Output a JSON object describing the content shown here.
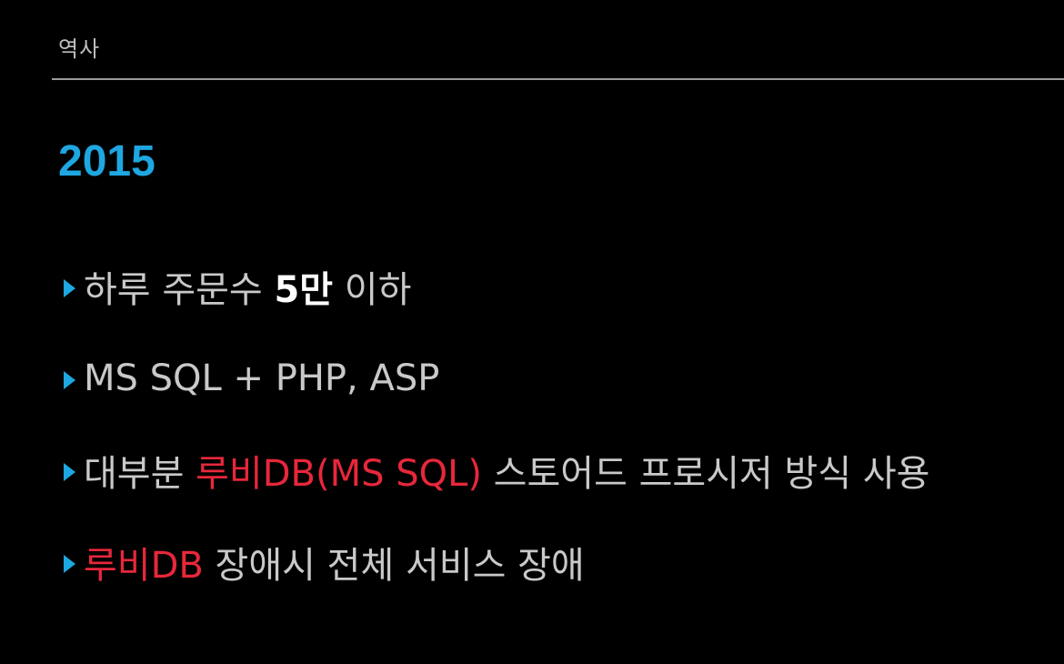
{
  "slide": {
    "section_label": "역사",
    "year": "2015",
    "colors": {
      "background": "#000000",
      "accent_blue": "#1ea7e1",
      "text_gray": "#c9c9c9",
      "highlight_red": "#e8273b",
      "emphasis_white": "#ffffff"
    },
    "bullets": [
      {
        "marker_icon": "triangle-right-icon",
        "segments": [
          {
            "text": "하루 주문수 ",
            "style": "normal"
          },
          {
            "text": "5만",
            "style": "strong"
          },
          {
            "text": " 이하",
            "style": "normal"
          }
        ]
      },
      {
        "marker_icon": "triangle-right-icon",
        "segments": [
          {
            "text": "MS SQL + PHP, ASP",
            "style": "normal"
          }
        ]
      },
      {
        "marker_icon": "triangle-right-icon",
        "segments": [
          {
            "text": "대부분 ",
            "style": "normal"
          },
          {
            "text": "루비DB(MS SQL)",
            "style": "red"
          },
          {
            "text": " 스토어드 프로시저 방식 사용",
            "style": "normal"
          }
        ]
      },
      {
        "marker_icon": "triangle-right-icon",
        "segments": [
          {
            "text": "루비DB",
            "style": "red"
          },
          {
            "text": " 장애시 전체 서비스 장애",
            "style": "normal"
          }
        ]
      }
    ]
  }
}
